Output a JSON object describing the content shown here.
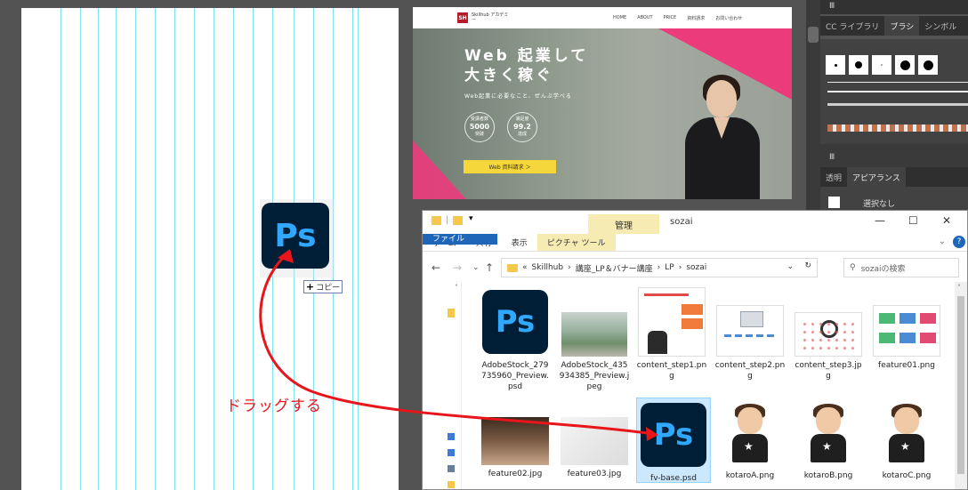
{
  "artboard": {
    "copy_tooltip_plus": "+",
    "copy_tooltip_label": "コピー",
    "drag_label": "ドラッグする",
    "ps_icon_text": "Ps"
  },
  "lp_preview": {
    "logo_mark": "SH",
    "logo_text": "Skillhub アカデミー",
    "nav": [
      "HOME",
      "ABOUT",
      "PRICE",
      "資料請求",
      "お問い合わせ"
    ],
    "headline_line1": "Web 起業して",
    "headline_line2": "大きく稼ぐ",
    "subtext": "Web起業に必要なこと、ぜんぶ学べる",
    "badge1_top": "受講者数",
    "badge1_value": "5000",
    "badge1_bottom": "突破",
    "badge2_top": "満足度",
    "badge2_value": "99.2",
    "badge2_bottom": "達成",
    "cta": "Web 資料請求 ＞"
  },
  "ai_panel": {
    "tabs_top": [
      "CC ライブラリ",
      "ブラシ",
      "シンボル"
    ],
    "tabs_bottom": [
      "透明",
      "アピアランス"
    ],
    "selection_label": "選択なし"
  },
  "explorer": {
    "context_tab": "管理",
    "title": "sozai",
    "ribbon_tabs": [
      "ファイル",
      "ホーム",
      "共有",
      "表示",
      "ピクチャ ツール"
    ],
    "breadcrumb": [
      "«",
      "Skillhub",
      "›",
      "講座_LP＆バナー講座",
      "›",
      "LP",
      "›",
      "sozai"
    ],
    "search_placeholder": "sozaiの検索",
    "files": [
      {
        "name": "AdobeStock_279735960_Preview.psd"
      },
      {
        "name": "AdobeStock_435934385_Preview.jpeg"
      },
      {
        "name": "content_step1.png"
      },
      {
        "name": "content_step2.png"
      },
      {
        "name": "content_step3.jpg"
      },
      {
        "name": "feature01.png"
      },
      {
        "name": "feature02.jpg"
      },
      {
        "name": "feature03.jpg"
      },
      {
        "name": "fv-base.psd"
      },
      {
        "name": "kotaroA.png"
      },
      {
        "name": "kotaroB.png"
      },
      {
        "name": "kotaroC.png"
      }
    ]
  },
  "colors": {
    "accent_red": "#e8151b",
    "ps_blue": "#31a8ff",
    "ps_dark": "#001e36",
    "lp_pink": "#ec3b7b",
    "lp_yellow": "#f5d63b"
  }
}
